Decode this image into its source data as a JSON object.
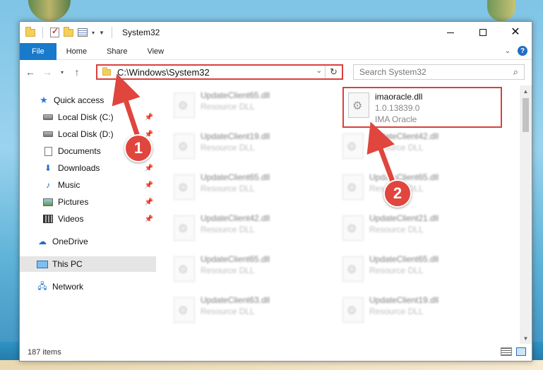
{
  "window": {
    "title": "System32"
  },
  "titlebar": {
    "minimize_label": "Minimize",
    "maximize_label": "Maximize",
    "close_label": "Close"
  },
  "ribbon": {
    "tabs": [
      {
        "label": "File"
      },
      {
        "label": "Home"
      },
      {
        "label": "Share"
      },
      {
        "label": "View"
      }
    ]
  },
  "address": {
    "path": "C:\\Windows\\System32"
  },
  "search": {
    "placeholder": "Search System32"
  },
  "navpane": {
    "items": [
      {
        "label": "Quick access",
        "icon": "star-icon",
        "pinned": false
      },
      {
        "label": "Local Disk (C:)",
        "icon": "drive-icon",
        "pinned": true
      },
      {
        "label": "Local Disk (D:)",
        "icon": "drive-icon",
        "pinned": true
      },
      {
        "label": "Documents",
        "icon": "documents-icon",
        "pinned": true
      },
      {
        "label": "Downloads",
        "icon": "download-icon",
        "pinned": true
      },
      {
        "label": "Music",
        "icon": "music-icon",
        "pinned": true
      },
      {
        "label": "Pictures",
        "icon": "pictures-icon",
        "pinned": true
      },
      {
        "label": "Videos",
        "icon": "videos-icon",
        "pinned": true
      },
      {
        "label": "OneDrive",
        "icon": "cloud-icon",
        "pinned": false
      },
      {
        "label": "This PC",
        "icon": "computer-icon",
        "pinned": false,
        "selected": true
      },
      {
        "label": "Network",
        "icon": "network-icon",
        "pinned": false
      }
    ]
  },
  "files": {
    "highlighted": {
      "name": "imaoracle.dll",
      "version": "1.0.13839.0",
      "company": "IMA Oracle"
    },
    "left_column": [
      {
        "name": "UpdateClient65.dll",
        "type": "Resource DLL"
      },
      {
        "name": "UpdateClient19.dll",
        "type": "Resource DLL"
      },
      {
        "name": "UpdateClient65.dll",
        "type": "Resource DLL"
      },
      {
        "name": "UpdateClient42.dll",
        "type": "Resource DLL"
      },
      {
        "name": "UpdateClient65.dll",
        "type": "Resource DLL"
      },
      {
        "name": "UpdateClient63.dll",
        "type": "Resource DLL"
      }
    ],
    "right_column": [
      {
        "name": "UpdateClient42.dll",
        "type": "Resource DLL"
      },
      {
        "name": "UpdateClient65.dll",
        "type": "Resource DLL"
      },
      {
        "name": "UpdateClient21.dll",
        "type": "Resource DLL"
      },
      {
        "name": "UpdateClient65.dll",
        "type": "Resource DLL"
      },
      {
        "name": "UpdateClient19.dll",
        "type": "Resource DLL"
      }
    ]
  },
  "statusbar": {
    "item_count": "187 items"
  },
  "annotations": {
    "step1": "1",
    "step2": "2",
    "color": "#e0453e"
  }
}
